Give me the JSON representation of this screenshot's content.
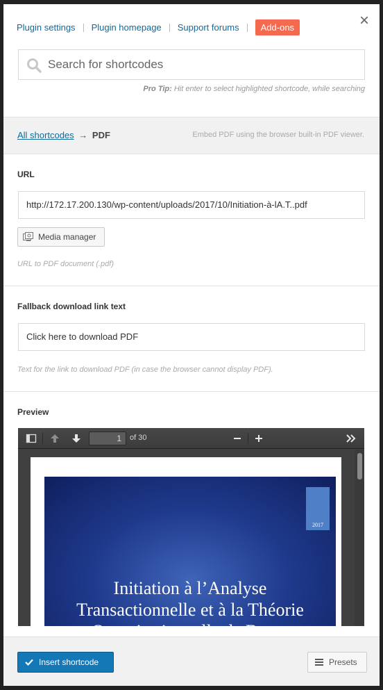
{
  "header": {
    "links": [
      "Plugin settings",
      "Plugin homepage",
      "Support forums"
    ],
    "addons_label": "Add-ons",
    "close_label": "×"
  },
  "search": {
    "placeholder": "Search for shortcodes",
    "protip_label": "Pro Tip:",
    "protip_text": "Hit enter to select highlighted shortcode, while searching"
  },
  "breadcrumb": {
    "root": "All shortcodes",
    "separator": "→",
    "current": "PDF",
    "description": "Embed PDF using the browser built-in PDF viewer."
  },
  "fields": {
    "url": {
      "label": "URL",
      "value": "http://172.17.200.130/wp-content/uploads/2017/10/Initiation-à-lA.T..pdf",
      "button": "Media manager",
      "hint": "URL to PDF document (.pdf)"
    },
    "fallback": {
      "label": "Fallback download link text",
      "value": "Click here to download PDF",
      "hint": "Text for the link to download PDF (in case the browser cannot display PDF)."
    }
  },
  "preview": {
    "label": "Preview",
    "page_number": "1",
    "page_count": "of 30",
    "slide_year": "2017",
    "slide_title_lines": [
      "Initiation à l’Analyse",
      "Transactionnelle et à la Théorie",
      "Organisationnelle de Berne"
    ]
  },
  "footer": {
    "insert_label": "Insert shortcode",
    "presets_label": "Presets"
  },
  "colors": {
    "link": "#0f6b9e",
    "addons_bg": "#f5694f",
    "primary_button": "#1578b6",
    "panel_bg": "#f1f1f1"
  }
}
